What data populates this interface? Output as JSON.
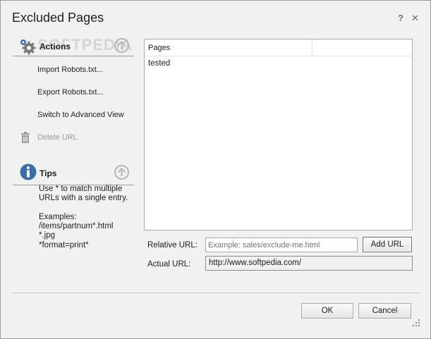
{
  "window": {
    "title": "Excluded Pages",
    "help_glyph": "?",
    "close_glyph": "✕"
  },
  "watermark": "SOFTPEDIA",
  "actions": {
    "header": "Actions",
    "items": [
      {
        "label": "Import Robots.txt...",
        "enabled": true
      },
      {
        "label": "Export Robots.txt...",
        "enabled": true
      },
      {
        "label": "Switch to Advanced View",
        "enabled": true
      },
      {
        "label": "Delete URL",
        "enabled": false
      }
    ]
  },
  "tips": {
    "header": "Tips",
    "text": "Use * to match multiple URLs with a single entry.\n\nExamples:\n/items/partnum*.html\n*.jpg\n*format=print*"
  },
  "pages_table": {
    "column": "Pages",
    "rows": [
      "tested"
    ]
  },
  "form": {
    "relative_label": "Relative URL:",
    "relative_placeholder": "Example: sales/exclude-me.html",
    "relative_value": "",
    "add_button": "Add URL",
    "actual_label": "Actual URL:",
    "actual_value": "http://www.softpedia.com/"
  },
  "footer": {
    "ok": "OK",
    "cancel": "Cancel"
  },
  "colors": {
    "info_icon": "#3a6ea5",
    "gear_blue": "#2f6fb5",
    "gear_gray": "#7a7a7a"
  },
  "icons": [
    "gear-icon",
    "collapse-up-icon",
    "trash-icon",
    "info-icon",
    "resize-grip-icon"
  ]
}
